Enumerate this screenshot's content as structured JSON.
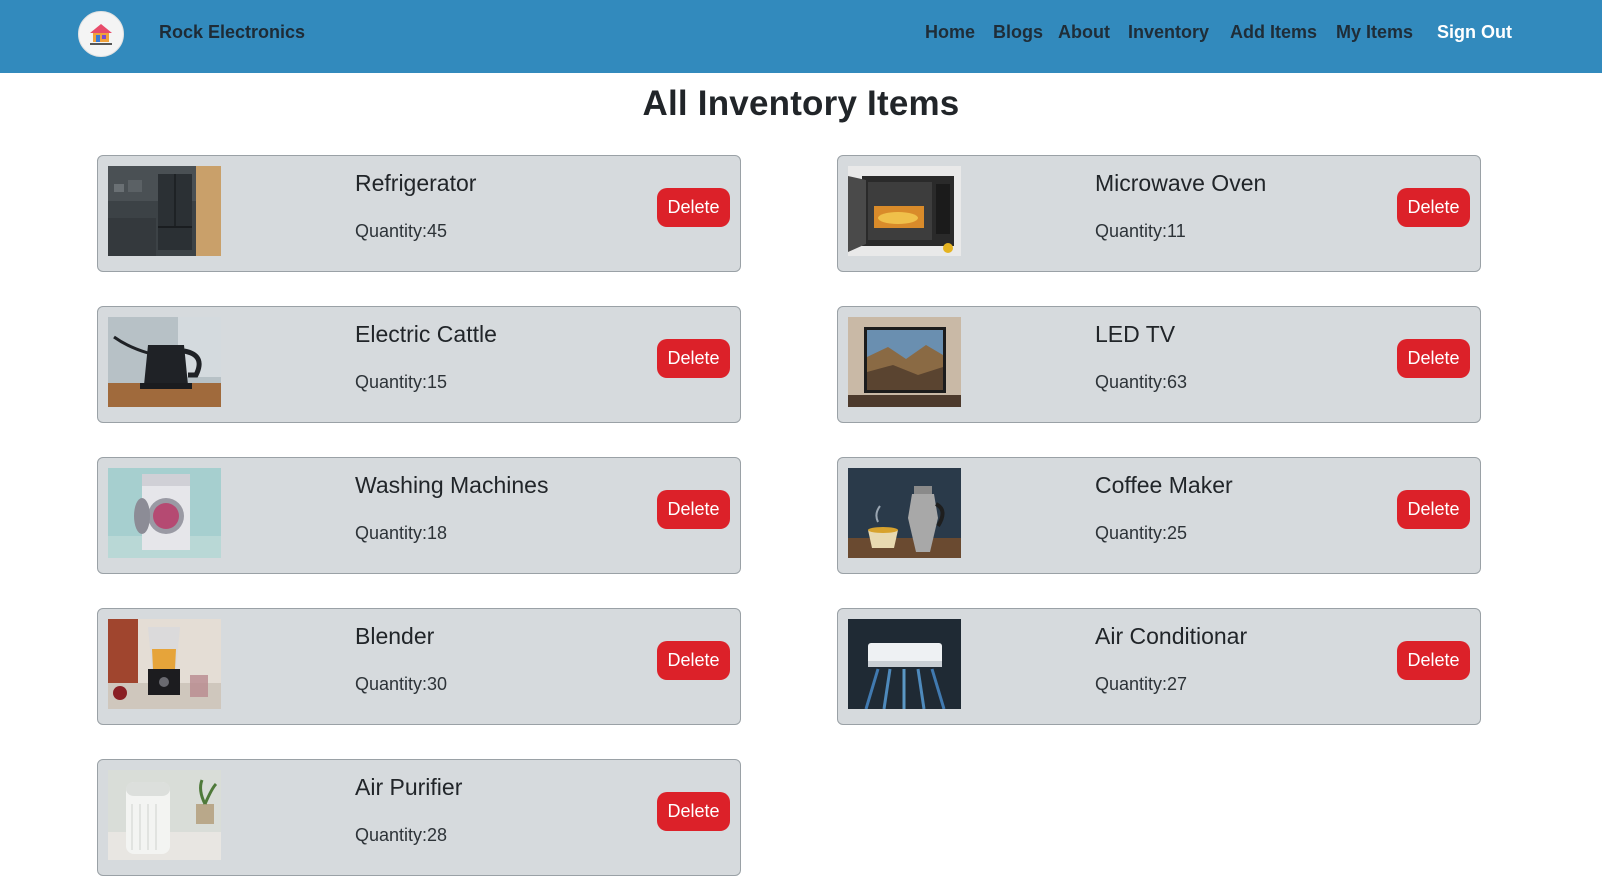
{
  "brand": {
    "name": "Rock Electronics",
    "logo_icon": "house-logo-icon"
  },
  "nav": {
    "links": [
      "Home",
      "Blogs",
      "About",
      "Inventory",
      "Add Items",
      "My Items"
    ],
    "signout": "Sign Out"
  },
  "page": {
    "title": "All Inventory Items"
  },
  "labels": {
    "quantity_prefix": "Quantity:",
    "delete": "Delete"
  },
  "colors": {
    "navbar": "#328abd",
    "card_background": "#d6dadd",
    "delete_button": "#dc2129"
  },
  "items": [
    {
      "name": "Refrigerator",
      "quantity": "45",
      "image_icon": "refrigerator-photo"
    },
    {
      "name": "Microwave Oven",
      "quantity": "11",
      "image_icon": "microwave-photo"
    },
    {
      "name": "Electric Cattle",
      "quantity": "15",
      "image_icon": "kettle-photo"
    },
    {
      "name": "LED TV",
      "quantity": "63",
      "image_icon": "tv-photo"
    },
    {
      "name": "Washing Machines",
      "quantity": "18",
      "image_icon": "washing-machine-photo"
    },
    {
      "name": "Coffee Maker",
      "quantity": "25",
      "image_icon": "coffee-maker-photo"
    },
    {
      "name": "Blender",
      "quantity": "30",
      "image_icon": "blender-photo"
    },
    {
      "name": "Air Conditionar",
      "quantity": "27",
      "image_icon": "air-conditioner-photo"
    },
    {
      "name": "Air Purifier",
      "quantity": "28",
      "image_icon": "air-purifier-photo"
    }
  ]
}
